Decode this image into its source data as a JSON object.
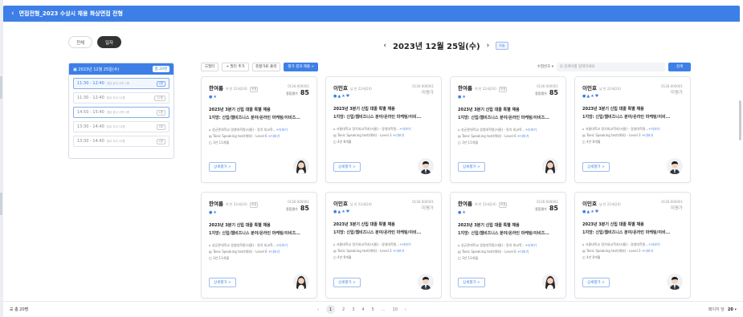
{
  "header": {
    "back_icon": "chevron-left-icon",
    "title": "면접전형_2023 수상시 채용 화상면접 전형"
  },
  "view_toggle": {
    "all": "전체",
    "daily": "일자"
  },
  "date_panel": {
    "date": "2023년 12월 25일(수)",
    "count": "총 20명",
    "slots": [
      {
        "time": "11:30 - 12:40",
        "place": "경남 본사 사옥 1층",
        "count": "4명"
      },
      {
        "time": "11:30 - 12:40",
        "place": "광교 지사 12층",
        "count": "12명"
      },
      {
        "time": "14:50 - 15:40",
        "place": "경남 본사 사옥 1층",
        "count": "4명"
      },
      {
        "time": "13:30 - 14:40",
        "place": "광교 지사 12층",
        "count": "4명"
      },
      {
        "time": "13:30 - 14:40",
        "place": "광교 지사 12층",
        "count": "4명"
      }
    ]
  },
  "date_nav": {
    "prev": "‹",
    "title": "2023년 12월 25일(수)",
    "next": "›",
    "today": "오늘"
  },
  "toolbar": {
    "filter": "필터",
    "add_filter": "+ 필터 추가",
    "export": "평가표 출력",
    "submit": "평가 결과 제출 >",
    "sort": "수험번호 ▾",
    "search_placeholder": "Q 검색어를 입력하세요",
    "search_btn": "검색"
  },
  "cards": [
    {
      "name": "한여름",
      "meta": "여 만 22세(24)",
      "badge": "모표",
      "num": "0136-000001",
      "score_label": "종합평가",
      "score": "85",
      "icons": "●★",
      "title": "2023년 3분기 신입 대졸 특별 채용",
      "desc": "1지망: 신입/웹비즈니스 분야/온라인 마케팅/이비즈...",
      "school": "성균관대학교 경영대학원(서울) - 정치 외교학...",
      "school_more": "+더보기",
      "toeic": "Toeic Speaking test(해외) - Level 6",
      "toeic_more": "+더보기",
      "exp": "3년 11개월",
      "detail": "상세평가 >",
      "gender": "f"
    },
    {
      "name": "이민호",
      "meta": "남 만 22세(24)",
      "badge": "",
      "num": "0136-000001",
      "score_label": "미평가",
      "score": "",
      "icons": "●▲★♥",
      "title": "2023년 3분기 신입 대졸 특별 채용",
      "desc": "1지망: 신입/웹비즈니스 분야/온라인 마케팅/이비...",
      "school": "서울대학교 정치외교학과(서울) - 경영대학원...",
      "school_more": "+더보기",
      "toeic": "Toeic Speaking test(해외) - Level 3",
      "toeic_more": "+더보기",
      "exp": "4년 8개월",
      "detail": "상세평가 >",
      "gender": "m"
    },
    {
      "name": "한여름",
      "meta": "여 만 22세(24)",
      "badge": "모표",
      "num": "0136-000001",
      "score_label": "종합평가",
      "score": "85",
      "icons": "●★",
      "title": "2023년 3분기 신입 대졸 특별 채용",
      "desc": "1지망: 신입/웹비즈니스 분야/온라인 마케팅/이비즈...",
      "school": "성균관대학교 경영대학원(서울) - 정치 외교학...",
      "school_more": "+더보기",
      "toeic": "Toeic Speaking test(해외) - Level 6",
      "toeic_more": "+더보기",
      "exp": "3년 11개월",
      "detail": "상세평가 >",
      "gender": "f"
    },
    {
      "name": "이민호",
      "meta": "남 만 22세(24)",
      "badge": "",
      "num": "0136-000001",
      "score_label": "미평가",
      "score": "",
      "icons": "●▲★♥",
      "title": "2023년 3분기 신입 대졸 특별 채용",
      "desc": "1지망: 신입/웹비즈니스 분야/온라인 마케팅/이비...",
      "school": "서울대학교 정치외교학과(서울) - 경영대학원...",
      "school_more": "+더보기",
      "toeic": "Toeic Speaking test(해외) - Level 3",
      "toeic_more": "+더보기",
      "exp": "4년 8개월",
      "detail": "상세평가 >",
      "gender": "m"
    },
    {
      "name": "한여름",
      "meta": "여 만 22세(24)",
      "badge": "모표",
      "num": "0136-000001",
      "score_label": "종합평가",
      "score": "85",
      "icons": "●★",
      "title": "2023년 3분기 신입 대졸 특별 채용",
      "desc": "1지망: 신입/웹비즈니스 분야/온라인 마케팅/이비즈...",
      "school": "성균관대학교 경영대학원(서울) - 정치 외교학...",
      "school_more": "+더보기",
      "toeic": "Toeic Speaking test(해외) - Level 6",
      "toeic_more": "+더보기",
      "exp": "3년 11개월",
      "detail": "상세평가 >",
      "gender": "f"
    },
    {
      "name": "이민호",
      "meta": "남 만 22세(24)",
      "badge": "",
      "num": "0136-000001",
      "score_label": "미평가",
      "score": "",
      "icons": "●▲★♥",
      "title": "2023년 3분기 신입 대졸 특별 채용",
      "desc": "1지망: 신입/웹비즈니스 분야/온라인 마케팅/이비...",
      "school": "서울대학교 정치외교학과(서울) - 경영대학원...",
      "school_more": "+더보기",
      "toeic": "Toeic Speaking test(해외) - Level 3",
      "toeic_more": "+더보기",
      "exp": "4년 8개월",
      "detail": "상세평가 >",
      "gender": "m"
    },
    {
      "name": "한여름",
      "meta": "여 만 22세(24)",
      "badge": "모표",
      "num": "0136-000001",
      "score_label": "종합평가",
      "score": "85",
      "icons": "●★",
      "title": "2023년 3분기 신입 대졸 특별 채용",
      "desc": "1지망: 신입/웹비즈니스 분야/온라인 마케팅/이비즈...",
      "school": "성균관대학교 경영대학원(서울) - 정치 외교학...",
      "school_more": "+더보기",
      "toeic": "Toeic Speaking test(해외) - Level 6",
      "toeic_more": "+더보기",
      "exp": "3년 11개월",
      "detail": "상세평가 >",
      "gender": "f"
    },
    {
      "name": "이민호",
      "meta": "남 만 22세(24)",
      "badge": "",
      "num": "0136-000001",
      "score_label": "미평가",
      "score": "",
      "icons": "●▲★♥",
      "title": "2023년 3분기 신입 대졸 특별 채용",
      "desc": "1지망: 신입/웹비즈니스 분야/온라인 마케팅/이비...",
      "school": "서울대학교 정치외교학과(서울) - 경영대학원...",
      "school_more": "+더보기",
      "toeic": "Toeic Speaking test(해외) - Level 3",
      "toeic_more": "+더보기",
      "exp": "4년 8개월",
      "detail": "상세평가 >",
      "gender": "m"
    }
  ],
  "footer": {
    "total": "☰ 총 20명",
    "pages": [
      "1",
      "2",
      "3",
      "4",
      "5",
      "...",
      "10"
    ],
    "prev": "‹",
    "next": "›",
    "per_page_label": "페이지 당",
    "per_page": "20"
  }
}
